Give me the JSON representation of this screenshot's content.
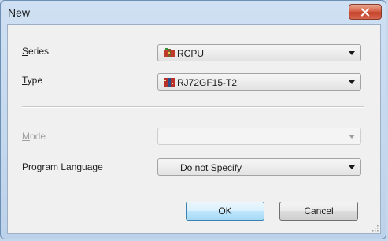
{
  "window": {
    "title": "New"
  },
  "form": {
    "series": {
      "label": "Series",
      "mnemonic": "S",
      "rest": "eries",
      "value": "RCPU",
      "icon": "cpu-module-icon"
    },
    "type": {
      "label": "Type",
      "mnemonic": "T",
      "rest": "ype",
      "value": "RJ72GF15-T2",
      "icon": "network-module-icon"
    },
    "mode": {
      "label": "Mode",
      "mnemonic": "M",
      "rest": "ode",
      "value": "",
      "disabled": true
    },
    "program_language": {
      "label": "Program Language",
      "value": "Do not Specify"
    }
  },
  "buttons": {
    "ok": "OK",
    "cancel": "Cancel"
  },
  "colors": {
    "close_button": "#c5422b",
    "ok_border": "#3c7fb1",
    "client_bg": "#f0f0f0",
    "frame": "#c4d7ec"
  }
}
